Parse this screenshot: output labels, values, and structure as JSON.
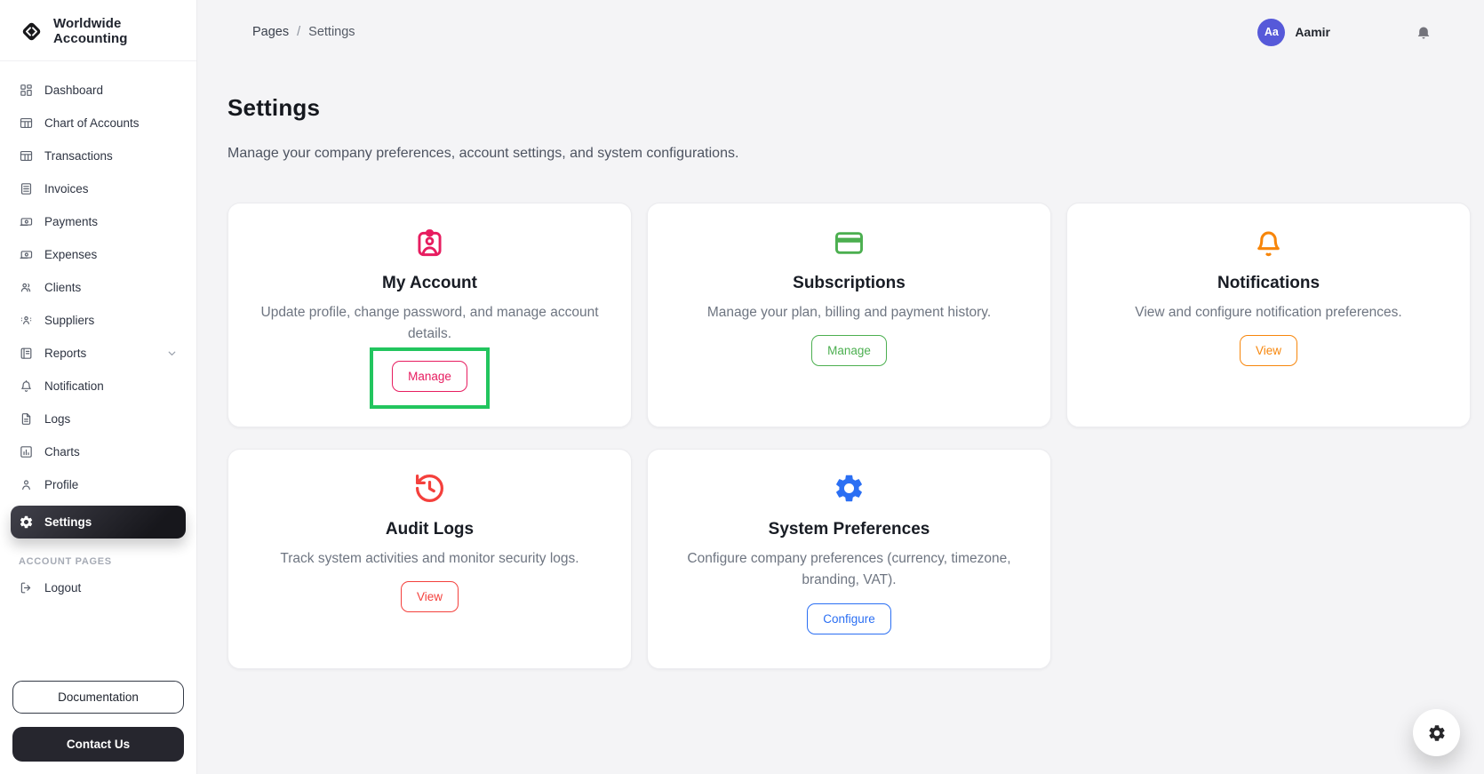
{
  "app": {
    "brand": "Worldwide Accounting"
  },
  "sidebar": {
    "nav": [
      {
        "label": "Dashboard",
        "icon": "dashboard-icon"
      },
      {
        "label": "Chart of Accounts",
        "icon": "table-icon"
      },
      {
        "label": "Transactions",
        "icon": "table-icon"
      },
      {
        "label": "Invoices",
        "icon": "invoice-icon"
      },
      {
        "label": "Payments",
        "icon": "banknote-icon"
      },
      {
        "label": "Expenses",
        "icon": "banknote-icon"
      },
      {
        "label": "Clients",
        "icon": "users-icon"
      },
      {
        "label": "Suppliers",
        "icon": "user-group-icon"
      },
      {
        "label": "Reports",
        "icon": "report-icon",
        "has_chevron": true
      },
      {
        "label": "Notification",
        "icon": "bell-icon"
      },
      {
        "label": "Logs",
        "icon": "file-icon"
      },
      {
        "label": "Charts",
        "icon": "bar-chart-icon"
      },
      {
        "label": "Profile",
        "icon": "user-icon"
      },
      {
        "label": "Settings",
        "icon": "gear-icon",
        "active": true
      }
    ],
    "account_section": {
      "label": "ACCOUNT PAGES",
      "logout_label": "Logout"
    },
    "documentation_button": "Documentation",
    "contact_button": "Contact Us"
  },
  "header": {
    "breadcrumb": {
      "parent": "Pages",
      "separator": "/",
      "current": "Settings"
    },
    "user": {
      "initials": "Aa",
      "name": "Aamir",
      "avatar_bg": "#5659d9"
    }
  },
  "page": {
    "title": "Settings",
    "subtitle": "Manage your company preferences, account settings, and system configurations."
  },
  "cards": [
    {
      "title": "My Account",
      "description": "Update profile, change password, and manage account details.",
      "button_label": "Manage",
      "accent": "#e71d60",
      "icon": "id-badge-icon",
      "highlighted": true
    },
    {
      "title": "Subscriptions",
      "description": "Manage your plan, billing and payment history.",
      "button_label": "Manage",
      "accent": "#4caf50",
      "icon": "credit-card-icon"
    },
    {
      "title": "Notifications",
      "description": "View and configure notification preferences.",
      "button_label": "View",
      "accent": "#f7860b",
      "icon": "bell-icon"
    },
    {
      "title": "Audit Logs",
      "description": "Track system activities and monitor security logs.",
      "button_label": "View",
      "accent": "#f4403c",
      "icon": "history-icon"
    },
    {
      "title": "System Preferences",
      "description": "Configure company preferences (currency, timezone, branding, VAT).",
      "button_label": "Configure",
      "accent": "#2b6ff3",
      "icon": "gear-icon"
    }
  ],
  "annotation": {
    "box_color": "#22c55e"
  }
}
